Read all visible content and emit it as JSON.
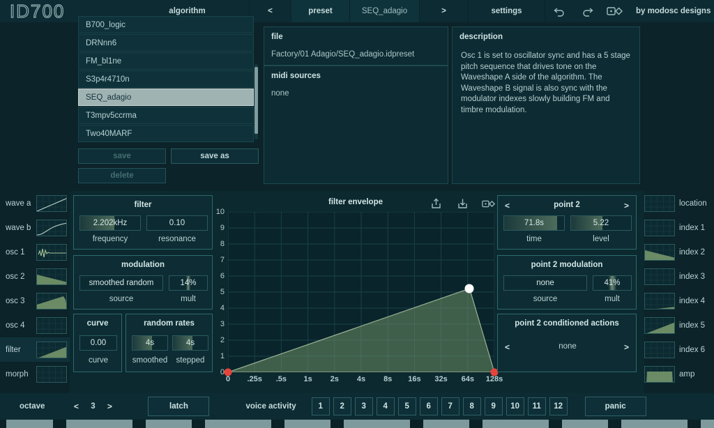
{
  "app": {
    "logo": "ID700",
    "credit": "by modosc designs"
  },
  "header": {
    "tabs": [
      {
        "label": "algorithm",
        "name": "tab-algorithm"
      },
      {
        "label": "<",
        "name": "preset-prev-button"
      },
      {
        "label": "preset",
        "name": "tab-preset"
      },
      {
        "label": "SEQ_adagio",
        "name": "preset-name-display"
      },
      {
        "label": ">",
        "name": "preset-next-button"
      },
      {
        "label": "settings",
        "name": "tab-settings"
      }
    ],
    "icons": [
      "undo-icon",
      "redo-icon",
      "randomize-icon"
    ]
  },
  "presets": {
    "items": [
      {
        "label": "B700_logic",
        "selected": false
      },
      {
        "label": "DRNnn6",
        "selected": false
      },
      {
        "label": "FM_bl1ne",
        "selected": false
      },
      {
        "label": "S3p4r4710n",
        "selected": false
      },
      {
        "label": "SEQ_adagio",
        "selected": true
      },
      {
        "label": "T3mpv5ccrma",
        "selected": false
      },
      {
        "label": "Two40MARF",
        "selected": false
      }
    ],
    "save_label": "save",
    "save_as_label": "save as",
    "delete_label": "delete"
  },
  "file": {
    "title": "file",
    "path": "Factory/01 Adagio/SEQ_adagio.idpreset"
  },
  "midi": {
    "title": "midi sources",
    "value": "none"
  },
  "description": {
    "title": "description",
    "body": "Osc 1 is set to oscillator sync and has a 5 stage pitch sequence that drives tone on the Waveshape A side of the algorithm.  The Waveshape B signal is also sync with the modulator indexes slowly building FM and timbre modulation."
  },
  "left_strip": [
    {
      "label": "wave a",
      "shape": "rising-line",
      "selected": false
    },
    {
      "label": "wave b",
      "shape": "curve-up",
      "selected": false
    },
    {
      "label": "osc 1",
      "shape": "noise-burst",
      "selected": false
    },
    {
      "label": "osc 2",
      "shape": "decay-ramp",
      "selected": false
    },
    {
      "label": "osc 3",
      "shape": "ramp-peak",
      "selected": false
    },
    {
      "label": "osc 4",
      "shape": "empty",
      "selected": false
    },
    {
      "label": "filter",
      "shape": "rising-ramp",
      "selected": true
    },
    {
      "label": "morph",
      "shape": "empty",
      "selected": false
    }
  ],
  "right_strip": [
    {
      "label": "location",
      "shape": "empty"
    },
    {
      "label": "index 1",
      "shape": "empty"
    },
    {
      "label": "index 2",
      "shape": "decay-ramp"
    },
    {
      "label": "index 3",
      "shape": "empty"
    },
    {
      "label": "index 4",
      "shape": "low-ramp"
    },
    {
      "label": "index 5",
      "shape": "rising-ramp"
    },
    {
      "label": "index 6",
      "shape": "empty"
    },
    {
      "label": "amp",
      "shape": "plateau"
    }
  ],
  "filter": {
    "title": "filter",
    "frequency": {
      "value": "2.202kHz",
      "label": "frequency",
      "fill_pct": 57
    },
    "resonance": {
      "value": "0.10",
      "label": "resonance",
      "fill_pct": 0
    }
  },
  "modulation": {
    "title": "modulation",
    "source": {
      "value": "smoothed random",
      "label": "source",
      "fill_pct": 0
    },
    "mult": {
      "value": "14%",
      "label": "mult",
      "fill_pct": 50
    }
  },
  "curve": {
    "title": "curve",
    "value": "0.00",
    "label": "curve"
  },
  "random_rates": {
    "title": "random rates",
    "smoothed": {
      "value": "4s",
      "label": "smoothed",
      "fill_pct": 55
    },
    "stepped": {
      "value": "4s",
      "label": "stepped",
      "fill_pct": 55
    }
  },
  "envelope": {
    "title": "filter envelope",
    "icons": [
      "export-icon",
      "import-icon",
      "randomize-icon"
    ]
  },
  "point": {
    "title": "point 2",
    "prev": "<",
    "next": ">",
    "time": {
      "value": "71.8s",
      "label": "time",
      "fill_pct": 88
    },
    "level": {
      "value": "5.22",
      "label": "level",
      "fill_pct": 52
    }
  },
  "point_modulation": {
    "title": "point 2 modulation",
    "source": {
      "value": "none",
      "label": "source",
      "fill_pct": 0
    },
    "mult": {
      "value": "41%",
      "label": "mult",
      "fill_pct": 50
    }
  },
  "point_conditioned_actions": {
    "title": "point 2 conditioned actions",
    "value": "none",
    "prev": "<",
    "next": ">"
  },
  "transport": {
    "octave_label": "octave",
    "octave_prev": "<",
    "octave_value": "3",
    "octave_next": ">",
    "latch_label": "latch",
    "voice_activity_label": "voice activity",
    "voices": [
      "1",
      "2",
      "3",
      "4",
      "5",
      "6",
      "7",
      "8",
      "9",
      "10",
      "11",
      "12"
    ],
    "panic_label": "panic"
  },
  "colors": {
    "background": "#0b2329",
    "panel": "#0d2c33",
    "border": "#2d6a6a",
    "text": "#bcd4d6",
    "accent_green": "#8fae78",
    "point_red": "#e8433a",
    "point_white": "#ffffff",
    "selected_preset": "#9fb3b3"
  },
  "chart_data": {
    "type": "line",
    "title": "filter envelope",
    "xlabel": "",
    "ylabel": "",
    "grid": true,
    "xtick_labels": [
      "0",
      ".25s",
      ".5s",
      "1s",
      "2s",
      "4s",
      "8s",
      "16s",
      "32s",
      "64s",
      "128s"
    ],
    "ytick_labels": [
      "0",
      "1",
      "2",
      "3",
      "4",
      "5",
      "6",
      "7",
      "8",
      "9",
      "10"
    ],
    "ylim": [
      0,
      10
    ],
    "points": [
      {
        "index": 1,
        "x_label": "0",
        "x_frac": 0.0,
        "level": 0.0,
        "state": "endpoint"
      },
      {
        "index": 2,
        "x_label": "71.8s",
        "x_frac": 0.907,
        "level": 5.22,
        "state": "selected"
      },
      {
        "index": 3,
        "x_label": "128s",
        "x_frac": 1.0,
        "level": 0.0,
        "state": "endpoint"
      }
    ],
    "fill": true,
    "fill_color": "#6d8f66"
  }
}
